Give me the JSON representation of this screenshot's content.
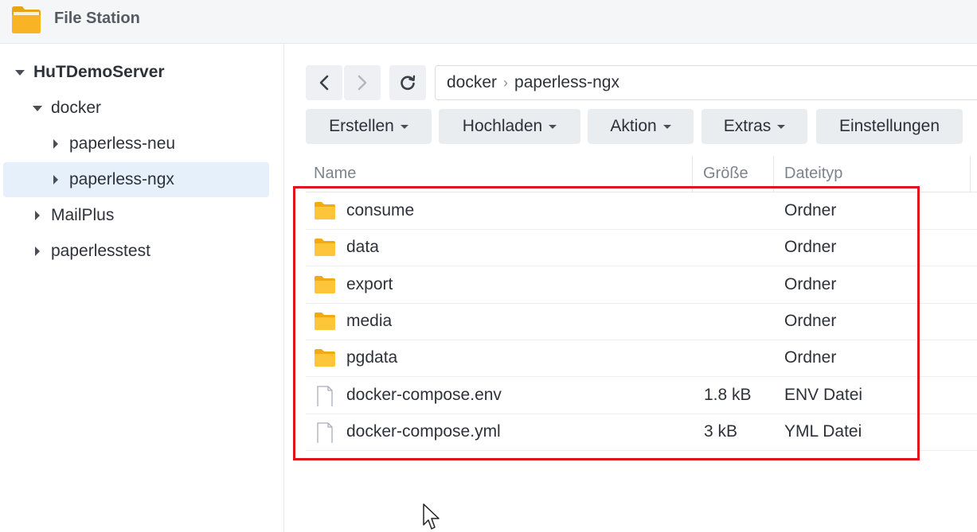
{
  "app": {
    "title": "File Station",
    "icon": "folder-app-icon"
  },
  "sidebar": {
    "items": [
      {
        "label": "HuTDemoServer",
        "expanded": true
      },
      {
        "label": "docker",
        "expanded": true
      },
      {
        "label": "paperless-neu",
        "expanded": false
      },
      {
        "label": "paperless-ngx",
        "expanded": false,
        "selected": true
      },
      {
        "label": "MailPlus",
        "expanded": false
      },
      {
        "label": "paperlesstest",
        "expanded": false
      }
    ]
  },
  "toolbar": {
    "back_icon": "chevron-left-icon",
    "forward_icon": "chevron-right-icon",
    "refresh_icon": "refresh-icon",
    "path": [
      "docker",
      "paperless-ngx"
    ],
    "path_separator": "›",
    "buttons": {
      "create": "Erstellen",
      "upload": "Hochladen",
      "action": "Aktion",
      "extras": "Extras",
      "settings": "Einstellungen"
    }
  },
  "table": {
    "headers": {
      "name": "Name",
      "size": "Größe",
      "type": "Dateityp"
    },
    "rows": [
      {
        "name": "consume",
        "size": "",
        "type": "Ordner",
        "icon": "folder-icon"
      },
      {
        "name": "data",
        "size": "",
        "type": "Ordner",
        "icon": "folder-icon"
      },
      {
        "name": "export",
        "size": "",
        "type": "Ordner",
        "icon": "folder-icon"
      },
      {
        "name": "media",
        "size": "",
        "type": "Ordner",
        "icon": "folder-icon"
      },
      {
        "name": "pgdata",
        "size": "",
        "type": "Ordner",
        "icon": "folder-icon"
      },
      {
        "name": "docker-compose.env",
        "size": "1.8 kB",
        "type": "ENV Datei",
        "icon": "file-icon"
      },
      {
        "name": "docker-compose.yml",
        "size": "3 kB",
        "type": "YML Datei",
        "icon": "file-icon"
      }
    ]
  },
  "colors": {
    "highlight": "#e0121f",
    "folder": "#f7c234",
    "selected_bg": "#e6f0fa"
  }
}
